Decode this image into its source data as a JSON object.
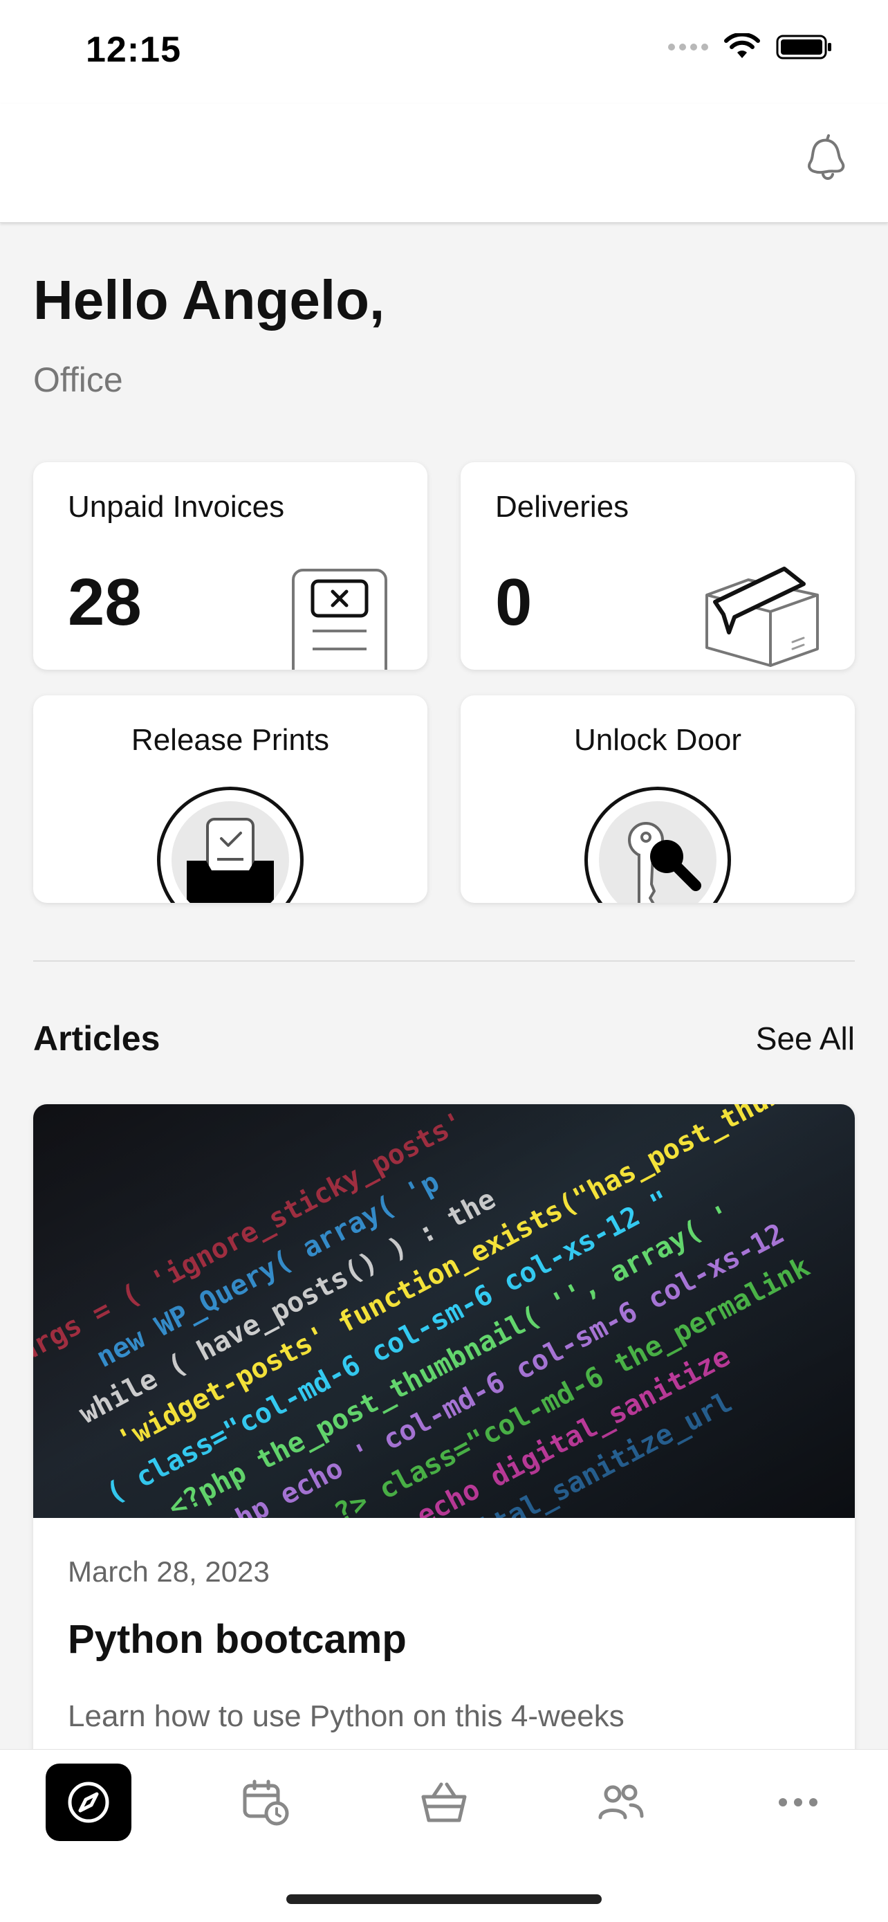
{
  "status_bar": {
    "time": "12:15"
  },
  "header": {
    "bell_icon": "bell-icon"
  },
  "greeting": "Hello Angelo,",
  "location": "Office",
  "stats": [
    {
      "label": "Unpaid Invoices",
      "value": "28",
      "icon": "invoice-icon"
    },
    {
      "label": "Deliveries",
      "value": "0",
      "icon": "package-icon"
    }
  ],
  "actions": [
    {
      "label": "Release Prints",
      "icon": "printer-tray-icon"
    },
    {
      "label": "Unlock Door",
      "icon": "key-search-icon"
    }
  ],
  "articles": {
    "title": "Articles",
    "see_all": "See All",
    "items": [
      {
        "date": "March 28, 2023",
        "title": "Python bootcamp",
        "excerpt": "Learn how to use Python on this 4-weeks",
        "image": "code-screen-photo"
      }
    ]
  },
  "tab_bar": {
    "tabs": [
      {
        "icon": "compass-icon",
        "active": true
      },
      {
        "icon": "calendar-clock-icon",
        "active": false
      },
      {
        "icon": "basket-icon",
        "active": false
      },
      {
        "icon": "people-icon",
        "active": false
      },
      {
        "icon": "more-icon",
        "active": false
      }
    ]
  },
  "colors": {
    "background": "#f4f4f4",
    "card": "#ffffff",
    "text_primary": "#111111",
    "text_secondary": "#777777",
    "active_tab": "#000000"
  }
}
